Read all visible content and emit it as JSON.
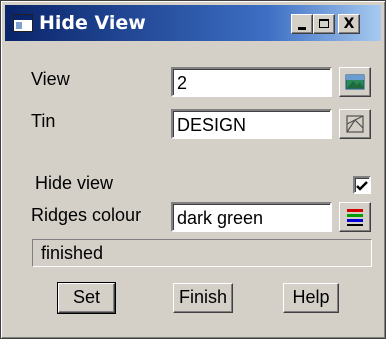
{
  "window": {
    "title": "Hide View",
    "controls": [
      "minimize-icon",
      "maximize-icon",
      "close-icon"
    ],
    "close_glyph": "X"
  },
  "form": {
    "view": {
      "label": "View",
      "value": "2",
      "icon": "view-picker-icon"
    },
    "tin": {
      "label": "Tin",
      "value": "DESIGN",
      "icon": "tin-picker-icon"
    },
    "hide_view": {
      "label": "Hide view",
      "checked": true
    },
    "ridges_colour": {
      "label": "Ridges colour",
      "value": "dark green",
      "icon": "colour-picker-icon"
    }
  },
  "status": {
    "text": "finished"
  },
  "buttons": {
    "set": "Set",
    "finish": "Finish",
    "help": "Help"
  },
  "colors": {
    "titlebar_start": "#0a246a",
    "titlebar_end": "#a6caf0",
    "dialog_bg": "#d4d0c8"
  }
}
